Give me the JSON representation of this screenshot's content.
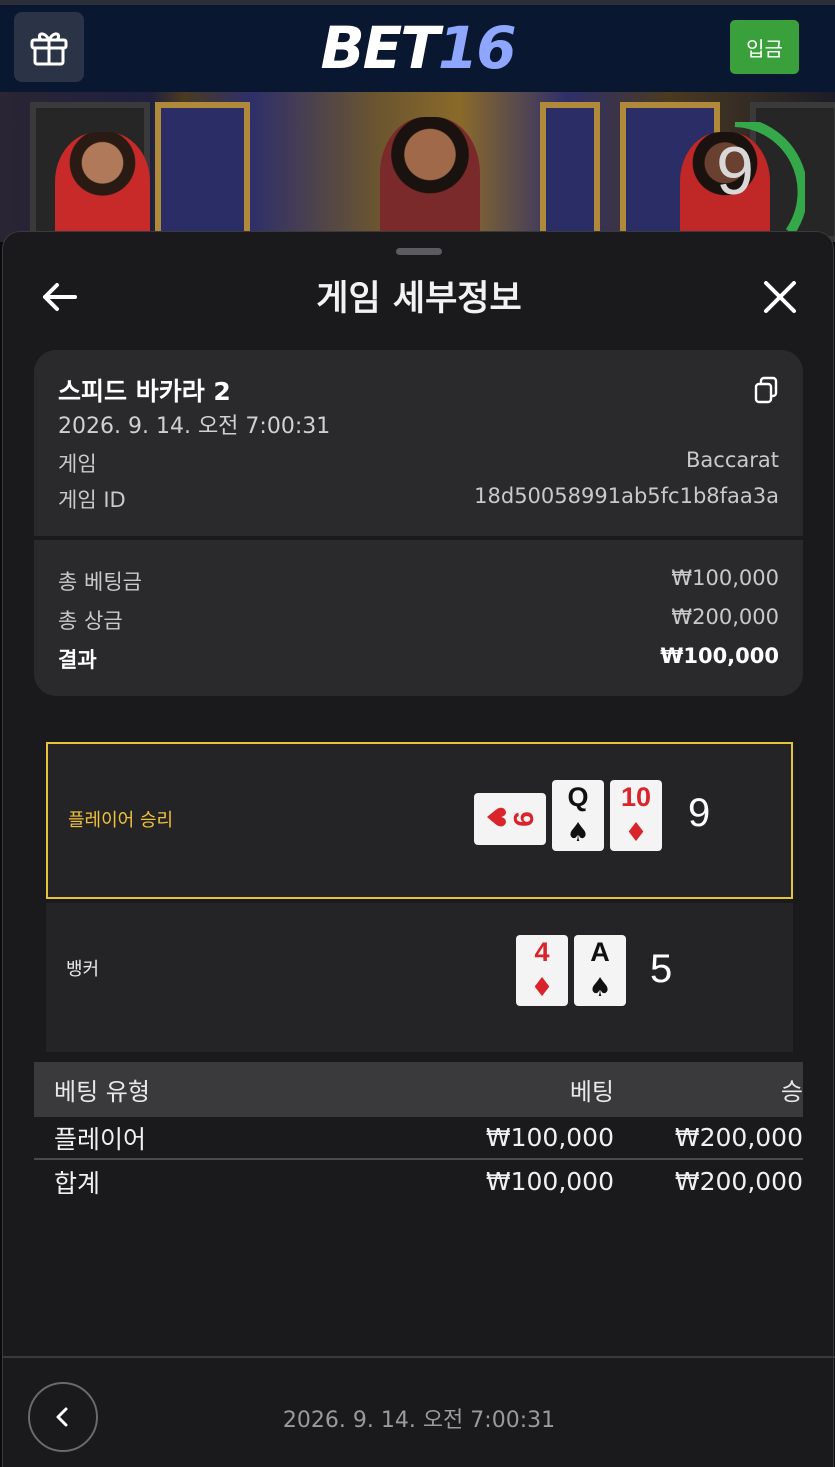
{
  "header": {
    "logo_part1": "BET",
    "logo_part2": "16",
    "deposit_label": "입금",
    "countdown": "9"
  },
  "sheet": {
    "title": "게임 세부정보"
  },
  "game_info": {
    "name": "스피드 바카라 2",
    "date": "2026. 9. 14. 오전 7:00:31",
    "game_label": "게임",
    "game_value": "Baccarat",
    "id_label": "게임 ID",
    "id_value": "18d50058991ab5fc1b8faa3a"
  },
  "summary": {
    "total_bet_label": "총 베팅금",
    "total_bet_value": "₩100,000",
    "total_prize_label": "총 상금",
    "total_prize_value": "₩200,000",
    "result_label": "결과",
    "result_value": "₩100,000"
  },
  "outcomes": {
    "player": {
      "label": "플레이어 승리",
      "score": "9",
      "cards": [
        {
          "rank": "9",
          "suit": "♥"
        },
        {
          "rank": "Q",
          "suit": "♠"
        },
        {
          "rank": "10",
          "suit": "♦"
        }
      ]
    },
    "banker": {
      "label": "뱅커",
      "score": "5",
      "cards": [
        {
          "rank": "4",
          "suit": "♦"
        },
        {
          "rank": "A",
          "suit": "♠"
        }
      ]
    }
  },
  "bet_table": {
    "headers": [
      "베팅 유형",
      "베팅",
      "승"
    ],
    "rows": [
      [
        "플레이어",
        "₩100,000",
        "₩200,000"
      ],
      [
        "합계",
        "₩100,000",
        "₩200,000"
      ]
    ]
  },
  "footer": {
    "date": "2026. 9. 14. 오전 7:00:31"
  },
  "colors": {
    "accent_gold": "#e7c23a",
    "deposit_green": "#3aa03c",
    "card_red": "#d8242a"
  }
}
